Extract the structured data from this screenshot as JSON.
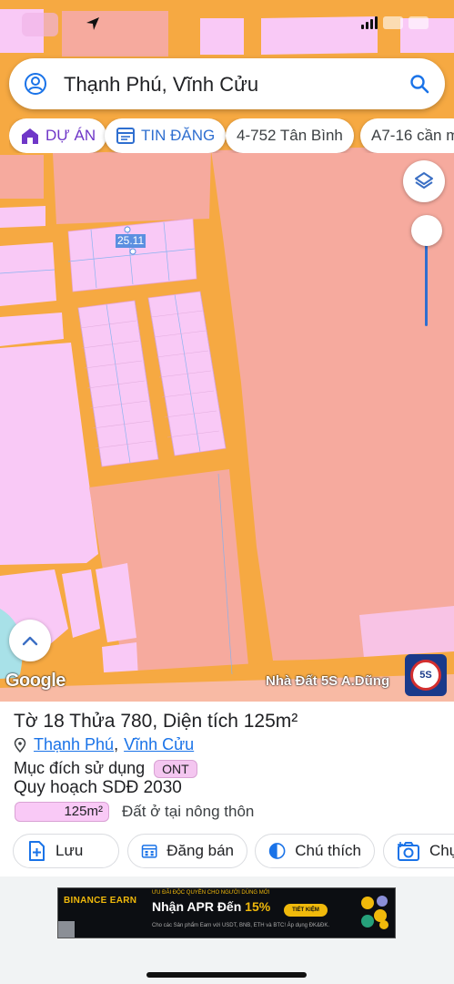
{
  "status_bar": {
    "icons": [
      "navigation-arrow-icon",
      "signal-icon",
      "wifi-icon",
      "battery-icon"
    ]
  },
  "search": {
    "query": "Thạnh Phú, Vĩnh Cửu",
    "icons": [
      "account-circle-icon",
      "search-icon"
    ]
  },
  "chips": [
    {
      "label": "DỰ ÁN",
      "icon": "house-icon",
      "color": "#6f37c8"
    },
    {
      "label": "TIN ĐĂNG",
      "icon": "listing-icon",
      "color": "#2f6fd0"
    },
    {
      "label": "4-752 Tân Bình"
    },
    {
      "label": "A7-16 cần m"
    }
  ],
  "map": {
    "plot_label": "25.11",
    "google_logo": "Google",
    "watermark": "Nhà Đất 5S A.Dũng",
    "brand_logo_text": "5S",
    "colors": {
      "road": "#f6a942",
      "agricultural_land": "#f6aa9e",
      "residential_land": "#f9c9f6",
      "water": "#a8e1e8",
      "plan_line": "#7fb1f0"
    }
  },
  "sheet": {
    "title": "Tờ 18 Thửa 780, Diện tích 125m²",
    "location": {
      "commune": "Thạnh Phú",
      "separator": ",",
      "district": "Vĩnh Cửu"
    },
    "land_use_label": "Mục đích sử dụng",
    "land_use_code": "ONT",
    "plan_title": "Quy hoạch SDĐ 2030",
    "legend_area": "125m²",
    "legend_desc": "Đất ở tại nông thôn",
    "actions": [
      {
        "label": "Lưu",
        "icon": "add-document-icon"
      },
      {
        "label": "Đăng bán",
        "icon": "calendar-grid-icon"
      },
      {
        "label": "Chú thích",
        "icon": "contrast-circle-icon"
      },
      {
        "label": "Chụ",
        "icon": "camera-icon"
      }
    ]
  },
  "ad": {
    "brand": "BINANCE EARN",
    "subtitle": "ƯU ĐÃI ĐỘC QUYỀN CHO NGƯỜI DÙNG MỚI",
    "headline_prefix": "Nhận APR Đến ",
    "headline_rate": "15%",
    "cta": "TIẾT KIỆM NGAY",
    "fine_print": "Cho các Sản phẩm Earn với USDT, BNB, ETH và BTC! Áp dụng ĐK&ĐK."
  }
}
